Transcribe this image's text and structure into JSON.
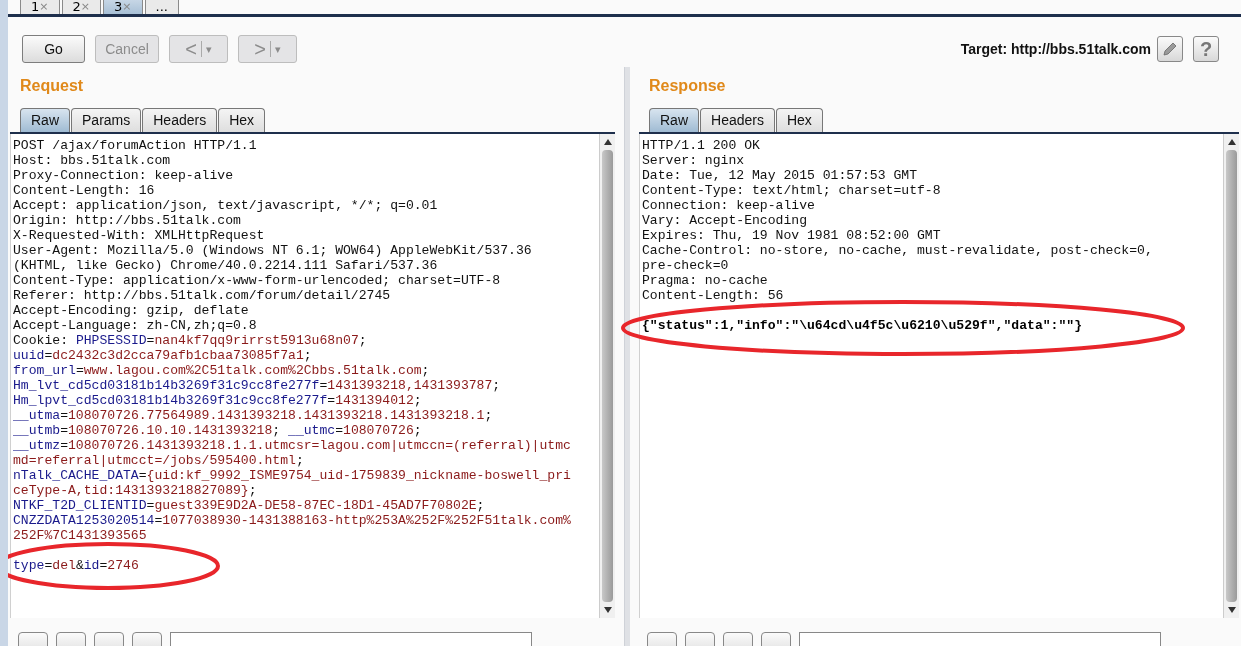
{
  "top_tabs": [
    {
      "label": "1",
      "close": "×",
      "selected": false
    },
    {
      "label": "2",
      "close": "×",
      "selected": false
    },
    {
      "label": "3",
      "close": "×",
      "selected": true
    },
    {
      "label": "...",
      "selected": false
    }
  ],
  "toolbar": {
    "buttons": [
      {
        "kind": "text",
        "label": "Go",
        "disabled": false
      },
      {
        "kind": "text",
        "label": "Cancel",
        "disabled": true
      },
      {
        "kind": "split",
        "label": "<",
        "caret": "▾",
        "disabled": true
      },
      {
        "kind": "split",
        "label": ">",
        "caret": "▾",
        "disabled": true
      }
    ],
    "target": "Target: http://bbs.51talk.com",
    "tools": [
      {
        "kind": "edit"
      },
      {
        "kind": "help",
        "label": "?"
      }
    ]
  },
  "request": {
    "title": "Request",
    "tabs": [
      {
        "label": "Raw",
        "selected": true
      },
      {
        "label": "Params",
        "selected": false
      },
      {
        "label": "Headers",
        "selected": false
      },
      {
        "label": "Hex",
        "selected": false
      }
    ],
    "lines": [
      [
        {
          "text": "POST /ajax/forumAction HTTP/1.1",
          "kind": "plain"
        }
      ],
      [
        {
          "text": "Host: bbs.51talk.com",
          "kind": "plain"
        }
      ],
      [
        {
          "text": "Proxy-Connection: keep-alive",
          "kind": "plain"
        }
      ],
      [
        {
          "text": "Content-Length: 16",
          "kind": "plain"
        }
      ],
      [
        {
          "text": "Accept: application/json, text/javascript, */*; q=0.01",
          "kind": "plain"
        }
      ],
      [
        {
          "text": "Origin: http://bbs.51talk.com",
          "kind": "plain"
        }
      ],
      [
        {
          "text": "X-Requested-With: XMLHttpRequest",
          "kind": "plain"
        }
      ],
      [
        {
          "text": "User-Agent: Mozilla/5.0 (Windows NT 6.1; WOW64) AppleWebKit/537.36",
          "kind": "plain"
        }
      ],
      [
        {
          "text": "(KHTML, like Gecko) Chrome/40.0.2214.111 Safari/537.36",
          "kind": "plain"
        }
      ],
      [
        {
          "text": "Content-Type: application/x-www-form-urlencoded; charset=UTF-8",
          "kind": "plain"
        }
      ],
      [
        {
          "text": "Referer: http://bbs.51talk.com/forum/detail/2745",
          "kind": "plain"
        }
      ],
      [
        {
          "text": "Accept-Encoding: gzip, deflate",
          "kind": "plain"
        }
      ],
      [
        {
          "text": "Accept-Language: zh-CN,zh;q=0.8",
          "kind": "plain"
        }
      ],
      [
        {
          "text": "Cookie: ",
          "kind": "plain"
        },
        {
          "text": "PHPSESSID",
          "kind": "name"
        },
        {
          "text": "=",
          "kind": "plain"
        },
        {
          "text": "nan4kf7qq9rirrst5913u68n07",
          "kind": "value"
        },
        {
          "text": ";",
          "kind": "plain"
        }
      ],
      [
        {
          "text": "uuid",
          "kind": "name"
        },
        {
          "text": "=",
          "kind": "plain"
        },
        {
          "text": "dc2432c3d2cca79afb1cbaa73085f7a1",
          "kind": "value"
        },
        {
          "text": ";",
          "kind": "plain"
        }
      ],
      [
        {
          "text": "from_url",
          "kind": "name"
        },
        {
          "text": "=",
          "kind": "plain"
        },
        {
          "text": "www.lagou.com%2C51talk.com%2Cbbs.51talk.com",
          "kind": "value"
        },
        {
          "text": ";",
          "kind": "plain"
        }
      ],
      [
        {
          "text": "Hm_lvt_cd5cd03181b14b3269f31c9cc8fe277f",
          "kind": "name"
        },
        {
          "text": "=",
          "kind": "plain"
        },
        {
          "text": "1431393218,1431393787",
          "kind": "value"
        },
        {
          "text": ";",
          "kind": "plain"
        }
      ],
      [
        {
          "text": "Hm_lpvt_cd5cd03181b14b3269f31c9cc8fe277f",
          "kind": "name"
        },
        {
          "text": "=",
          "kind": "plain"
        },
        {
          "text": "1431394012",
          "kind": "value"
        },
        {
          "text": ";",
          "kind": "plain"
        }
      ],
      [
        {
          "text": "__utma",
          "kind": "name"
        },
        {
          "text": "=",
          "kind": "plain"
        },
        {
          "text": "108070726.77564989.1431393218.1431393218.1431393218.1",
          "kind": "value"
        },
        {
          "text": ";",
          "kind": "plain"
        }
      ],
      [
        {
          "text": "__utmb",
          "kind": "name"
        },
        {
          "text": "=",
          "kind": "plain"
        },
        {
          "text": "108070726.10.10.1431393218",
          "kind": "value"
        },
        {
          "text": "; ",
          "kind": "plain"
        },
        {
          "text": "__utmc",
          "kind": "name"
        },
        {
          "text": "=",
          "kind": "plain"
        },
        {
          "text": "108070726",
          "kind": "value"
        },
        {
          "text": ";",
          "kind": "plain"
        }
      ],
      [
        {
          "text": "__utmz",
          "kind": "name"
        },
        {
          "text": "=",
          "kind": "plain"
        },
        {
          "text": "108070726.1431393218.1.1.utmcsr=lagou.com|utmccn=(referral)|utmc",
          "kind": "value"
        }
      ],
      [
        {
          "text": "md=referral|utmcct=/jobs/595400.html",
          "kind": "value"
        },
        {
          "text": ";",
          "kind": "plain"
        }
      ],
      [
        {
          "text": "nTalk_CACHE_DATA",
          "kind": "name"
        },
        {
          "text": "=",
          "kind": "plain"
        },
        {
          "text": "{uid:kf_9992_ISME9754_uid-1759839_nickname-boswell_pri",
          "kind": "value"
        }
      ],
      [
        {
          "text": "ceType-A,tid:1431393218827089}",
          "kind": "value"
        },
        {
          "text": ";",
          "kind": "plain"
        }
      ],
      [
        {
          "text": "NTKF_T2D_CLIENTID",
          "kind": "name"
        },
        {
          "text": "=",
          "kind": "plain"
        },
        {
          "text": "guest339E9D2A-DE58-87EC-18D1-45AD7F70802E",
          "kind": "value"
        },
        {
          "text": ";",
          "kind": "plain"
        }
      ],
      [
        {
          "text": "CNZZDATA1253020514",
          "kind": "name"
        },
        {
          "text": "=",
          "kind": "plain"
        },
        {
          "text": "1077038930-1431388163-http%253A%252F%252F51talk.com%",
          "kind": "value"
        }
      ],
      [
        {
          "text": "252F%7C1431393565",
          "kind": "value"
        }
      ]
    ],
    "body": [
      [
        {
          "text": "type",
          "kind": "name"
        },
        {
          "text": "=",
          "kind": "plain"
        },
        {
          "text": "del",
          "kind": "value"
        },
        {
          "text": "&",
          "kind": "plain"
        },
        {
          "text": "id",
          "kind": "name"
        },
        {
          "text": "=",
          "kind": "plain"
        },
        {
          "text": "2746",
          "kind": "value"
        }
      ]
    ]
  },
  "response": {
    "title": "Response",
    "tabs": [
      {
        "label": "Raw",
        "selected": true
      },
      {
        "label": "Headers",
        "selected": false
      },
      {
        "label": "Hex",
        "selected": false
      }
    ],
    "lines": [
      [
        {
          "text": "HTTP/1.1 200 OK",
          "kind": "plain"
        }
      ],
      [
        {
          "text": "Server: nginx",
          "kind": "plain"
        }
      ],
      [
        {
          "text": "Date: Tue, 12 May 2015 01:57:53 GMT",
          "kind": "plain"
        }
      ],
      [
        {
          "text": "Content-Type: text/html; charset=utf-8",
          "kind": "plain"
        }
      ],
      [
        {
          "text": "Connection: keep-alive",
          "kind": "plain"
        }
      ],
      [
        {
          "text": "Vary: Accept-Encoding",
          "kind": "plain"
        }
      ],
      [
        {
          "text": "Expires: Thu, 19 Nov 1981 08:52:00 GMT",
          "kind": "plain"
        }
      ],
      [
        {
          "text": "Cache-Control: no-store, no-cache, must-revalidate, post-check=0,",
          "kind": "plain"
        }
      ],
      [
        {
          "text": "pre-check=0",
          "kind": "plain"
        }
      ],
      [
        {
          "text": "Pragma: no-cache",
          "kind": "plain"
        }
      ],
      [
        {
          "text": "Content-Length: 56",
          "kind": "plain"
        }
      ]
    ],
    "body": [
      [
        {
          "text": "{\"status\":1,\"info\":\"\\u64cd\\u4f5c\\u6210\\u529f\",\"data\":\"\"}",
          "kind": "bold"
        }
      ]
    ]
  }
}
